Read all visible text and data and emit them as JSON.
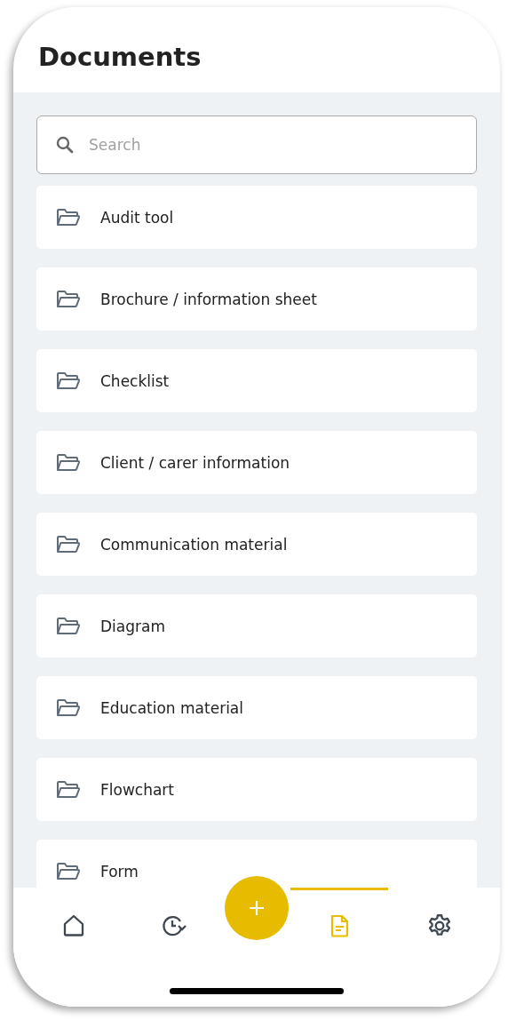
{
  "header": {
    "title": "Documents"
  },
  "search": {
    "placeholder": "Search"
  },
  "folders": [
    {
      "label": "Audit tool"
    },
    {
      "label": "Brochure / information sheet"
    },
    {
      "label": "Checklist"
    },
    {
      "label": "Client / carer information"
    },
    {
      "label": "Communication material"
    },
    {
      "label": "Diagram"
    },
    {
      "label": "Education material"
    },
    {
      "label": "Flowchart"
    },
    {
      "label": "Form"
    }
  ],
  "nav": {
    "items": [
      {
        "kind": "home",
        "selected": false
      },
      {
        "kind": "history",
        "selected": false
      },
      {
        "kind": "add",
        "selected": false
      },
      {
        "kind": "documents",
        "selected": true
      },
      {
        "kind": "settings",
        "selected": false
      }
    ]
  }
}
